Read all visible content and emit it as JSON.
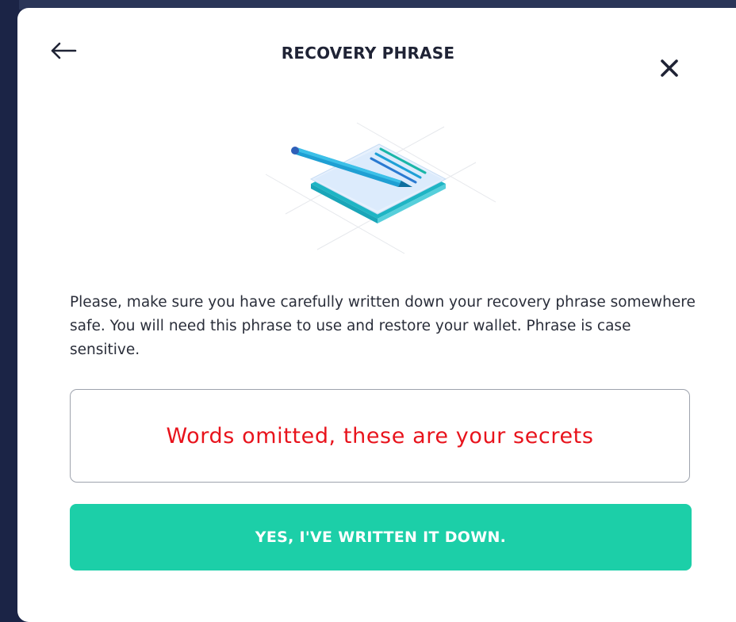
{
  "modal": {
    "title": "RECOVERY PHRASE",
    "description": "Please, make sure you have carefully written down your recovery phrase somewhere safe. You will need this phrase to use and restore your wallet. Phrase is case sensitive.",
    "phrase_placeholder": "Words omitted, these are your secrets",
    "confirm_label": "YES, I'VE WRITTEN IT DOWN.",
    "icons": {
      "back": "arrow-left-icon",
      "close": "close-icon",
      "illustration": "notepad-pen-illustration"
    }
  },
  "colors": {
    "accent": "#1ccfa8",
    "redacted_text": "#e8131c",
    "title": "#1f2335",
    "backdrop": "#1b2446"
  }
}
